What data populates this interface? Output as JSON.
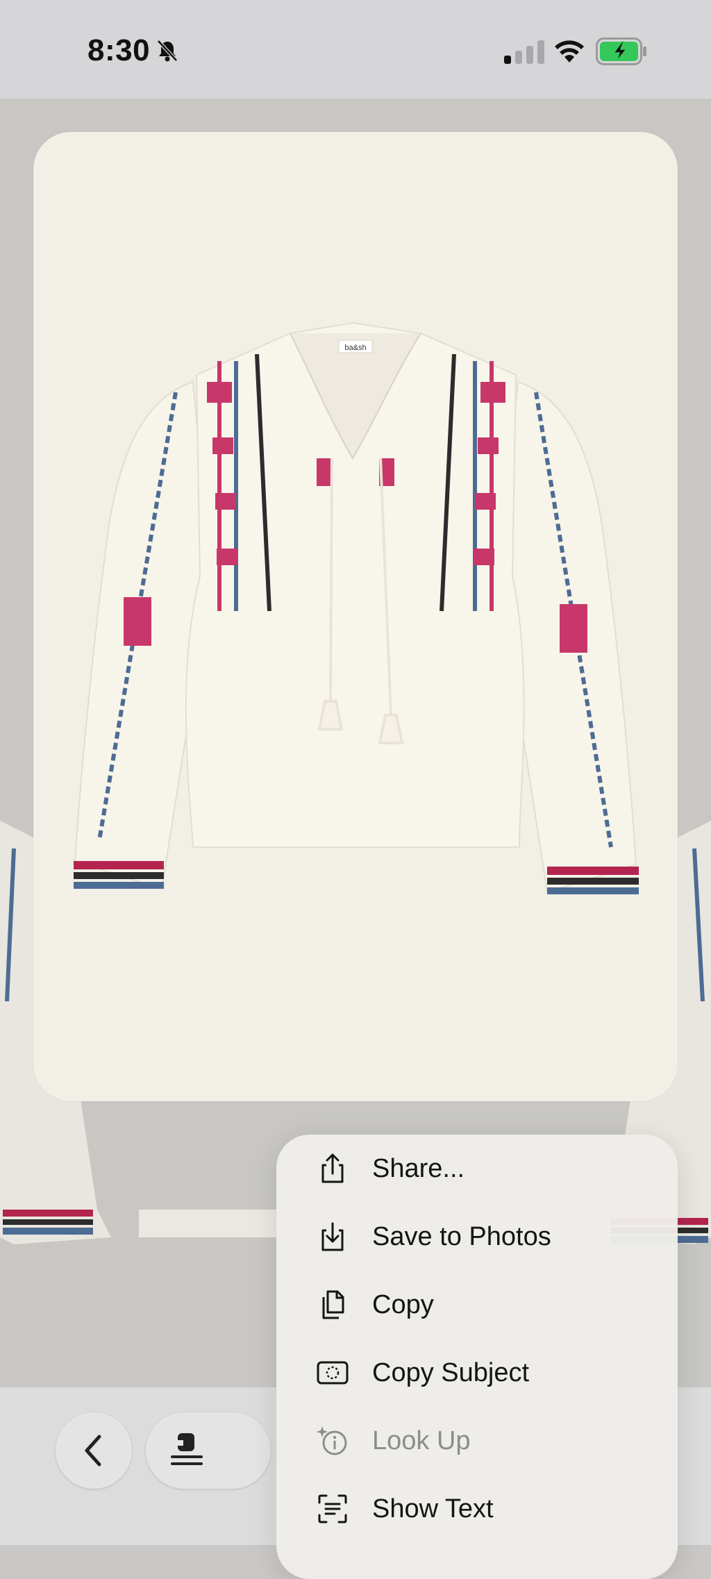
{
  "status_bar": {
    "time": "8:30",
    "icons": [
      "bell-slash-icon",
      "cellular-signal-icon",
      "wifi-icon",
      "battery-charging-icon"
    ],
    "battery_color": "#34c759"
  },
  "photo": {
    "description_icon": "blouse-image",
    "label_text": "ba&sh"
  },
  "toolbar": {
    "back_icon": "chevron-left-icon",
    "doc_icon": "info-document-icon"
  },
  "context_menu": {
    "items": [
      {
        "label": "Share...",
        "icon": "share-icon",
        "enabled": true
      },
      {
        "label": "Save to Photos",
        "icon": "save-to-photos-icon",
        "enabled": true
      },
      {
        "label": "Copy",
        "icon": "copy-icon",
        "enabled": true
      },
      {
        "label": "Copy Subject",
        "icon": "copy-subject-icon",
        "enabled": true
      },
      {
        "label": "Look Up",
        "icon": "look-up-icon",
        "enabled": false
      },
      {
        "label": "Show Text",
        "icon": "show-text-icon",
        "enabled": true
      }
    ]
  }
}
